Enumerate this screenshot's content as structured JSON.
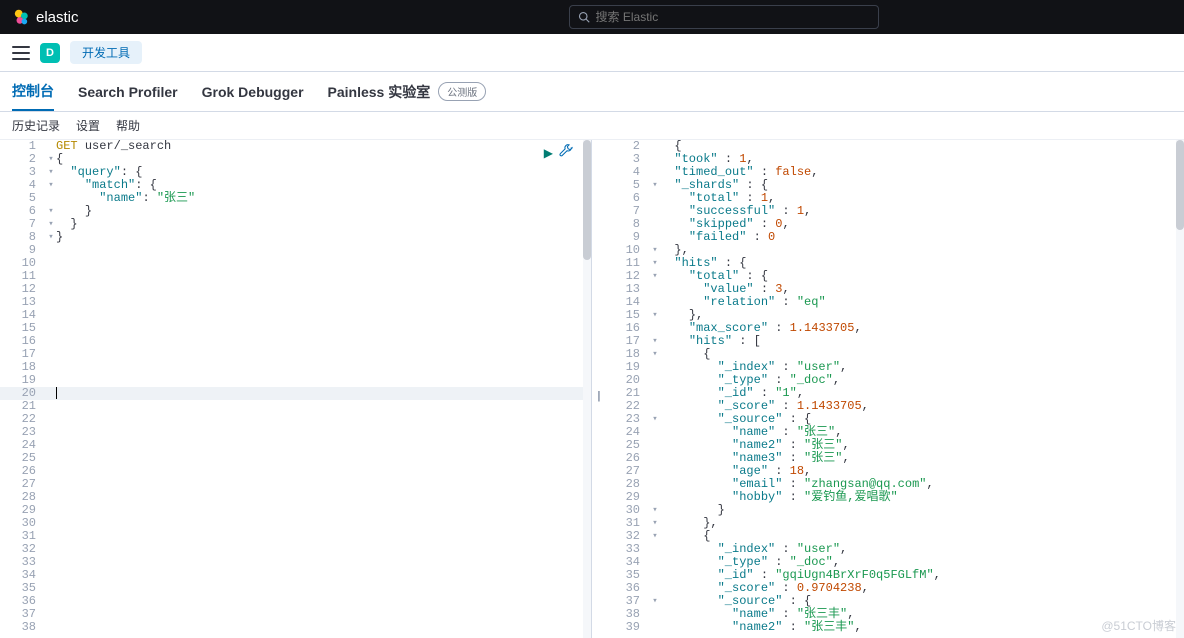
{
  "topbar": {
    "brand": "elastic",
    "search_placeholder": "搜索 Elastic"
  },
  "secondbar": {
    "space_letter": "D",
    "breadcrumb": "开发工具"
  },
  "tabs": [
    {
      "label": "控制台",
      "active": true
    },
    {
      "label": "Search Profiler"
    },
    {
      "label": "Grok Debugger"
    },
    {
      "label": "Painless 实验室",
      "badge": "公测版"
    }
  ],
  "subbar": {
    "history": "历史记录",
    "settings": "设置",
    "help": "帮助"
  },
  "request": {
    "method": "GET",
    "path": "user/_search",
    "lines": [
      {
        "n": 1,
        "fold": "",
        "indent": 0,
        "tokens": [
          [
            "method",
            "GET"
          ],
          [
            "plain",
            " "
          ],
          [
            "plain",
            "user/_search"
          ]
        ]
      },
      {
        "n": 2,
        "fold": "▾",
        "indent": 0,
        "tokens": [
          [
            "punc",
            "{"
          ]
        ]
      },
      {
        "n": 3,
        "fold": "▾",
        "indent": 1,
        "tokens": [
          [
            "key",
            "\"query\""
          ],
          [
            "punc",
            ": {"
          ]
        ]
      },
      {
        "n": 4,
        "fold": "▾",
        "indent": 2,
        "tokens": [
          [
            "key",
            "\"match\""
          ],
          [
            "punc",
            ": {"
          ]
        ]
      },
      {
        "n": 5,
        "fold": "",
        "indent": 3,
        "tokens": [
          [
            "key",
            "\"name\""
          ],
          [
            "punc",
            ": "
          ],
          [
            "str",
            "\"张三\""
          ]
        ]
      },
      {
        "n": 6,
        "fold": "▾",
        "indent": 2,
        "tokens": [
          [
            "punc",
            "}"
          ]
        ]
      },
      {
        "n": 7,
        "fold": "▾",
        "indent": 1,
        "tokens": [
          [
            "punc",
            "}"
          ]
        ]
      },
      {
        "n": 8,
        "fold": "▾",
        "indent": 0,
        "tokens": [
          [
            "punc",
            "}"
          ]
        ]
      }
    ],
    "blank_lines_end": 38,
    "highlight_line": 20
  },
  "response": {
    "lines": [
      {
        "n": 2,
        "fold": "",
        "indent": 1,
        "tokens": [
          [
            "punc",
            "{"
          ]
        ]
      },
      {
        "n": 3,
        "fold": "",
        "indent": 1,
        "tokens": [
          [
            "key",
            "\"took\""
          ],
          [
            "punc",
            " : "
          ],
          [
            "num",
            "1"
          ],
          [
            "punc",
            ","
          ]
        ]
      },
      {
        "n": 4,
        "fold": "",
        "indent": 1,
        "tokens": [
          [
            "key",
            "\"timed_out\""
          ],
          [
            "punc",
            " : "
          ],
          [
            "bool",
            "false"
          ],
          [
            "punc",
            ","
          ]
        ]
      },
      {
        "n": 5,
        "fold": "▾",
        "indent": 1,
        "tokens": [
          [
            "key",
            "\"_shards\""
          ],
          [
            "punc",
            " : {"
          ]
        ]
      },
      {
        "n": 6,
        "fold": "",
        "indent": 2,
        "tokens": [
          [
            "key",
            "\"total\""
          ],
          [
            "punc",
            " : "
          ],
          [
            "num",
            "1"
          ],
          [
            "punc",
            ","
          ]
        ]
      },
      {
        "n": 7,
        "fold": "",
        "indent": 2,
        "tokens": [
          [
            "key",
            "\"successful\""
          ],
          [
            "punc",
            " : "
          ],
          [
            "num",
            "1"
          ],
          [
            "punc",
            ","
          ]
        ]
      },
      {
        "n": 8,
        "fold": "",
        "indent": 2,
        "tokens": [
          [
            "key",
            "\"skipped\""
          ],
          [
            "punc",
            " : "
          ],
          [
            "num",
            "0"
          ],
          [
            "punc",
            ","
          ]
        ]
      },
      {
        "n": 9,
        "fold": "",
        "indent": 2,
        "tokens": [
          [
            "key",
            "\"failed\""
          ],
          [
            "punc",
            " : "
          ],
          [
            "num",
            "0"
          ]
        ]
      },
      {
        "n": 10,
        "fold": "▾",
        "indent": 1,
        "tokens": [
          [
            "punc",
            "},"
          ]
        ]
      },
      {
        "n": 11,
        "fold": "▾",
        "indent": 1,
        "tokens": [
          [
            "key",
            "\"hits\""
          ],
          [
            "punc",
            " : {"
          ]
        ]
      },
      {
        "n": 12,
        "fold": "▾",
        "indent": 2,
        "tokens": [
          [
            "key",
            "\"total\""
          ],
          [
            "punc",
            " : {"
          ]
        ]
      },
      {
        "n": 13,
        "fold": "",
        "indent": 3,
        "tokens": [
          [
            "key",
            "\"value\""
          ],
          [
            "punc",
            " : "
          ],
          [
            "num",
            "3"
          ],
          [
            "punc",
            ","
          ]
        ]
      },
      {
        "n": 14,
        "fold": "",
        "indent": 3,
        "tokens": [
          [
            "key",
            "\"relation\""
          ],
          [
            "punc",
            " : "
          ],
          [
            "str",
            "\"eq\""
          ]
        ]
      },
      {
        "n": 15,
        "fold": "▾",
        "indent": 2,
        "tokens": [
          [
            "punc",
            "},"
          ]
        ]
      },
      {
        "n": 16,
        "fold": "",
        "indent": 2,
        "tokens": [
          [
            "key",
            "\"max_score\""
          ],
          [
            "punc",
            " : "
          ],
          [
            "num",
            "1.1433705"
          ],
          [
            "punc",
            ","
          ]
        ]
      },
      {
        "n": 17,
        "fold": "▾",
        "indent": 2,
        "tokens": [
          [
            "key",
            "\"hits\""
          ],
          [
            "punc",
            " : ["
          ]
        ]
      },
      {
        "n": 18,
        "fold": "▾",
        "indent": 3,
        "tokens": [
          [
            "punc",
            "{"
          ]
        ]
      },
      {
        "n": 19,
        "fold": "",
        "indent": 4,
        "tokens": [
          [
            "key",
            "\"_index\""
          ],
          [
            "punc",
            " : "
          ],
          [
            "str",
            "\"user\""
          ],
          [
            "punc",
            ","
          ]
        ]
      },
      {
        "n": 20,
        "fold": "",
        "indent": 4,
        "tokens": [
          [
            "key",
            "\"_type\""
          ],
          [
            "punc",
            " : "
          ],
          [
            "str",
            "\"_doc\""
          ],
          [
            "punc",
            ","
          ]
        ]
      },
      {
        "n": 21,
        "fold": "",
        "indent": 4,
        "tokens": [
          [
            "key",
            "\"_id\""
          ],
          [
            "punc",
            " : "
          ],
          [
            "str",
            "\"1\""
          ],
          [
            "punc",
            ","
          ]
        ]
      },
      {
        "n": 22,
        "fold": "",
        "indent": 4,
        "tokens": [
          [
            "key",
            "\"_score\""
          ],
          [
            "punc",
            " : "
          ],
          [
            "num",
            "1.1433705"
          ],
          [
            "punc",
            ","
          ]
        ]
      },
      {
        "n": 23,
        "fold": "▾",
        "indent": 4,
        "tokens": [
          [
            "key",
            "\"_source\""
          ],
          [
            "punc",
            " : {"
          ]
        ]
      },
      {
        "n": 24,
        "fold": "",
        "indent": 5,
        "tokens": [
          [
            "key",
            "\"name\""
          ],
          [
            "punc",
            " : "
          ],
          [
            "str",
            "\"张三\""
          ],
          [
            "punc",
            ","
          ]
        ]
      },
      {
        "n": 25,
        "fold": "",
        "indent": 5,
        "tokens": [
          [
            "key",
            "\"name2\""
          ],
          [
            "punc",
            " : "
          ],
          [
            "str",
            "\"张三\""
          ],
          [
            "punc",
            ","
          ]
        ]
      },
      {
        "n": 26,
        "fold": "",
        "indent": 5,
        "tokens": [
          [
            "key",
            "\"name3\""
          ],
          [
            "punc",
            " : "
          ],
          [
            "str",
            "\"张三\""
          ],
          [
            "punc",
            ","
          ]
        ]
      },
      {
        "n": 27,
        "fold": "",
        "indent": 5,
        "tokens": [
          [
            "key",
            "\"age\""
          ],
          [
            "punc",
            " : "
          ],
          [
            "num",
            "18"
          ],
          [
            "punc",
            ","
          ]
        ]
      },
      {
        "n": 28,
        "fold": "",
        "indent": 5,
        "tokens": [
          [
            "key",
            "\"email\""
          ],
          [
            "punc",
            " : "
          ],
          [
            "str",
            "\"zhangsan@qq.com\""
          ],
          [
            "punc",
            ","
          ]
        ]
      },
      {
        "n": 29,
        "fold": "",
        "indent": 5,
        "tokens": [
          [
            "key",
            "\"hobby\""
          ],
          [
            "punc",
            " : "
          ],
          [
            "str",
            "\"爱钓鱼,爱唱歌\""
          ]
        ]
      },
      {
        "n": 30,
        "fold": "▾",
        "indent": 4,
        "tokens": [
          [
            "punc",
            "}"
          ]
        ]
      },
      {
        "n": 31,
        "fold": "▾",
        "indent": 3,
        "tokens": [
          [
            "punc",
            "},"
          ]
        ]
      },
      {
        "n": 32,
        "fold": "▾",
        "indent": 3,
        "tokens": [
          [
            "punc",
            "{"
          ]
        ]
      },
      {
        "n": 33,
        "fold": "",
        "indent": 4,
        "tokens": [
          [
            "key",
            "\"_index\""
          ],
          [
            "punc",
            " : "
          ],
          [
            "str",
            "\"user\""
          ],
          [
            "punc",
            ","
          ]
        ]
      },
      {
        "n": 34,
        "fold": "",
        "indent": 4,
        "tokens": [
          [
            "key",
            "\"_type\""
          ],
          [
            "punc",
            " : "
          ],
          [
            "str",
            "\"_doc\""
          ],
          [
            "punc",
            ","
          ]
        ]
      },
      {
        "n": 35,
        "fold": "",
        "indent": 4,
        "tokens": [
          [
            "key",
            "\"_id\""
          ],
          [
            "punc",
            " : "
          ],
          [
            "str",
            "\"gqiUgn4BrXrF0q5FGLfM\""
          ],
          [
            "punc",
            ","
          ]
        ]
      },
      {
        "n": 36,
        "fold": "",
        "indent": 4,
        "tokens": [
          [
            "key",
            "\"_score\""
          ],
          [
            "punc",
            " : "
          ],
          [
            "num",
            "0.9704238"
          ],
          [
            "punc",
            ","
          ]
        ]
      },
      {
        "n": 37,
        "fold": "▾",
        "indent": 4,
        "tokens": [
          [
            "key",
            "\"_source\""
          ],
          [
            "punc",
            " : {"
          ]
        ]
      },
      {
        "n": 38,
        "fold": "",
        "indent": 5,
        "tokens": [
          [
            "key",
            "\"name\""
          ],
          [
            "punc",
            " : "
          ],
          [
            "str",
            "\"张三丰\""
          ],
          [
            "punc",
            ","
          ]
        ]
      },
      {
        "n": 39,
        "fold": "",
        "indent": 5,
        "tokens": [
          [
            "key",
            "\"name2\""
          ],
          [
            "punc",
            " : "
          ],
          [
            "str",
            "\"张三丰\""
          ],
          [
            "punc",
            ","
          ]
        ]
      }
    ]
  },
  "watermark": "@51CTO博客"
}
